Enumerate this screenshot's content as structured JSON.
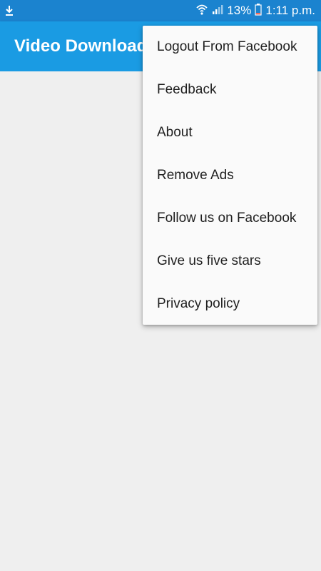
{
  "status_bar": {
    "left_icon": "download-icon",
    "wifi_icon": "wifi-icon",
    "signal_icon": "signal-icon",
    "battery_icon": "battery-icon",
    "battery_percent": "13%",
    "time": "1:11 p.m."
  },
  "app_bar": {
    "title": "Video Download"
  },
  "menu": {
    "items": [
      {
        "label": "Logout From Facebook"
      },
      {
        "label": "Feedback"
      },
      {
        "label": "About"
      },
      {
        "label": "Remove Ads"
      },
      {
        "label": "Follow us on Facebook"
      },
      {
        "label": "Give us five stars"
      },
      {
        "label": "Privacy policy"
      }
    ]
  },
  "colors": {
    "status_bar": "#1b83cf",
    "app_bar": "#1a9be3",
    "background": "#efefef",
    "menu_background": "#fafafa"
  }
}
